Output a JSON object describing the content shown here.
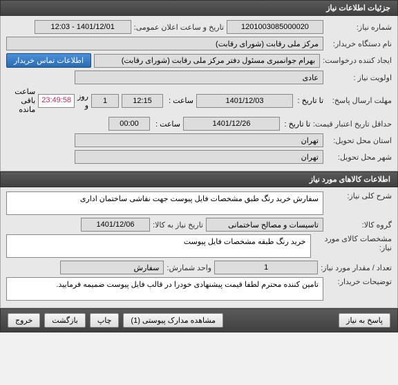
{
  "section1": {
    "title": "جزئیات اطلاعات نیاز",
    "need_number_label": "شماره نیاز:",
    "need_number": "1201003085000020",
    "public_datetime_label": "تاریخ و ساعت اعلان عمومی:",
    "public_datetime": "1401/12/01 - 12:03",
    "buyer_org_label": "نام دستگاه خریدار:",
    "buyer_org": "مرکز ملی رقابت (شورای رقابت)",
    "requester_label": "ایجاد کننده درخواست:",
    "requester": "بهرام جوانمیری مسئول دفتر مرکز ملی رقابت (شورای رقابت)",
    "contact_btn": "اطلاعات تماس خریدار",
    "priority_label": "اولویت نیاز :",
    "priority": "عادی",
    "reply_deadline_label": "مهلت ارسال پاسخ:",
    "to_date_label": "تا تاریخ :",
    "reply_date": "1401/12/03",
    "time_label": "ساعت :",
    "reply_time": "12:15",
    "days_count": "1",
    "days_label": "روز و",
    "countdown": "23:49:58",
    "remaining_label": "ساعت باقی مانده",
    "price_validity_label": "حداقل تاریخ اعتبار قیمت:",
    "price_date": "1401/12/26",
    "price_time": "00:00",
    "delivery_province_label": "استان محل تحویل:",
    "delivery_province": "تهران",
    "delivery_city_label": "شهر محل تحویل:",
    "delivery_city": "تهران"
  },
  "section2": {
    "title": "اطلاعات کالاهای مورد نیاز",
    "general_desc_label": "شرح کلی نیاز:",
    "general_desc": "سفارش خرید رنگ طبق مشخصات فایل پیوست جهت نقاشی ساختمان اداری",
    "goods_group_label": "گروه کالا:",
    "goods_group": "تاسیسات و مصالح ساختمانی",
    "goods_date_label": "تاریخ نیاز به کالا:",
    "goods_date": "1401/12/06",
    "goods_spec_label": "مشخصات کالای مورد نیاز:",
    "goods_spec": "خرید رنگ طبقه مشخصات فایل پیوست",
    "quantity_label": "تعداد / مقدار مورد نیاز:",
    "quantity": "1",
    "unit_label": "واحد شمارش:",
    "unit": "سفارش",
    "buyer_notes_label": "توضیحات خریدار:",
    "buyer_notes": "تامین کننده محترم لطفا قیمت پیشنهادی خودرا در قالب فایل پیوست ضمیمه فرمایید."
  },
  "footer": {
    "reply_btn": "پاسخ به نیاز",
    "attachments_btn": "مشاهده مدارک پیوستی (1)",
    "print_btn": "چاپ",
    "back_btn": "بازگشت",
    "exit_btn": "خروج"
  }
}
